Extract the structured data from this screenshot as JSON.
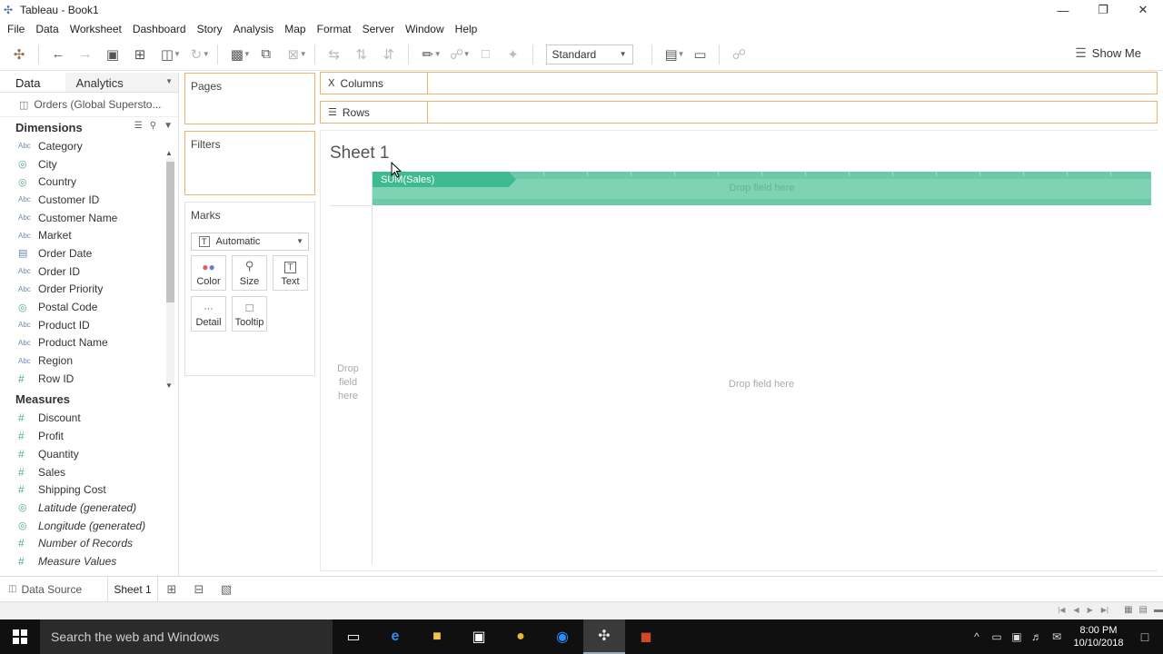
{
  "window": {
    "title": "Tableau - Book1"
  },
  "menu": [
    "File",
    "Data",
    "Worksheet",
    "Dashboard",
    "Story",
    "Analysis",
    "Map",
    "Format",
    "Server",
    "Window",
    "Help"
  ],
  "toolbar": {
    "fit_value": "Standard",
    "show_me": "Show Me"
  },
  "data_pane": {
    "tab_data": "Data",
    "tab_analytics": "Analytics",
    "datasource": "Orders (Global Supersto...",
    "dimensions_title": "Dimensions",
    "dimensions": [
      {
        "label": "Category",
        "type": "Abc"
      },
      {
        "label": "City",
        "type": "globe"
      },
      {
        "label": "Country",
        "type": "globe"
      },
      {
        "label": "Customer ID",
        "type": "Abc"
      },
      {
        "label": "Customer Name",
        "type": "Abc"
      },
      {
        "label": "Market",
        "type": "Abc"
      },
      {
        "label": "Order Date",
        "type": "calendar"
      },
      {
        "label": "Order ID",
        "type": "Abc"
      },
      {
        "label": "Order Priority",
        "type": "Abc"
      },
      {
        "label": "Postal Code",
        "type": "globe"
      },
      {
        "label": "Product ID",
        "type": "Abc"
      },
      {
        "label": "Product Name",
        "type": "Abc"
      },
      {
        "label": "Region",
        "type": "Abc"
      },
      {
        "label": "Row ID",
        "type": "#"
      }
    ],
    "measures_title": "Measures",
    "measures": [
      {
        "label": "Discount",
        "type": "#"
      },
      {
        "label": "Profit",
        "type": "#"
      },
      {
        "label": "Quantity",
        "type": "#"
      },
      {
        "label": "Sales",
        "type": "#"
      },
      {
        "label": "Shipping Cost",
        "type": "#"
      },
      {
        "label": "Latitude (generated)",
        "type": "globe"
      },
      {
        "label": "Longitude (generated)",
        "type": "globe"
      },
      {
        "label": "Number of Records",
        "type": "#"
      },
      {
        "label": "Measure Values",
        "type": "#"
      }
    ]
  },
  "cards": {
    "pages": "Pages",
    "filters": "Filters",
    "marks": "Marks",
    "marks_type": "Automatic",
    "mark_buttons": [
      "Color",
      "Size",
      "Text",
      "Detail",
      "Tooltip"
    ]
  },
  "shelves": {
    "columns": "Columns",
    "rows": "Rows"
  },
  "view": {
    "sheet_title": "Sheet 1",
    "dragged_pill": "SUM(Sales)",
    "drop_band_hint": "Drop field here",
    "drop_center_hint": "Drop field here",
    "drop_rows_hint": "Drop field here"
  },
  "sheet_tabs": {
    "data_source": "Data Source",
    "sheet": "Sheet 1"
  },
  "taskbar": {
    "search_placeholder": "Search the web and Windows",
    "time": "8:00 PM",
    "date": "10/10/2018"
  }
}
